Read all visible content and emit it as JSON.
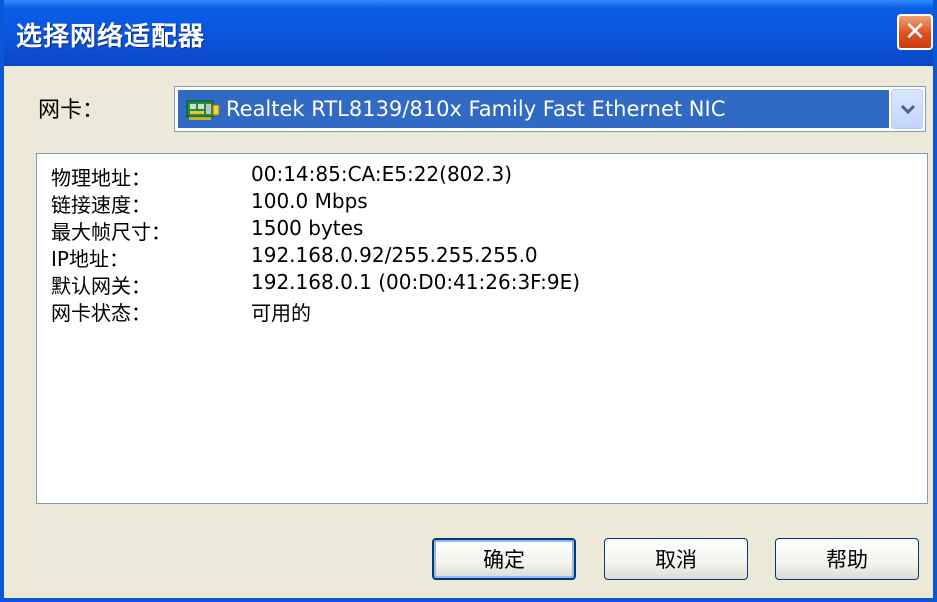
{
  "window": {
    "title": "选择网络适配器",
    "close_glyph": "✕"
  },
  "adapter": {
    "label": "网卡：",
    "selected": "Realtek RTL8139/810x Family Fast Ethernet NIC",
    "icon": "network-card-icon"
  },
  "info": {
    "rows": [
      {
        "key": "物理地址：",
        "value": "00:14:85:CA:E5:22(802.3)"
      },
      {
        "key": "链接速度：",
        "value": "100.0 Mbps"
      },
      {
        "key": "最大帧尺寸：",
        "value": "1500 bytes"
      },
      {
        "key": "IP地址：",
        "value": "192.168.0.92/255.255.255.0"
      },
      {
        "key": "默认网关：",
        "value": "192.168.0.1 (00:D0:41:26:3F:9E)"
      },
      {
        "key": "网卡状态：",
        "value": "可用的"
      }
    ]
  },
  "buttons": {
    "ok": "确定",
    "cancel": "取消",
    "help": "帮助"
  },
  "colors": {
    "titlebar": "#0a56e0",
    "selection": "#316ac5",
    "close": "#e0501f"
  }
}
